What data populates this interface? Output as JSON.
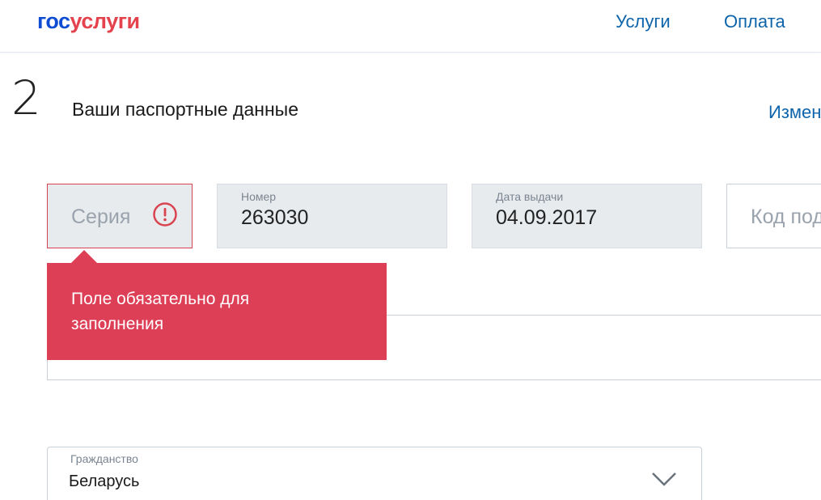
{
  "header": {
    "logo_part1": "гос",
    "logo_part2": "услуги",
    "nav": [
      {
        "label": "Услуги"
      },
      {
        "label": "Оплата"
      }
    ]
  },
  "step": {
    "number": "2",
    "title": "Ваши паспортные данные",
    "edit_label": "Измен"
  },
  "passport": {
    "series": {
      "placeholder": "Серия",
      "value": "",
      "state": "error"
    },
    "number": {
      "label": "Номер",
      "value": "263030"
    },
    "issue_date": {
      "label": "Дата выдачи",
      "value": "04.09.2017"
    },
    "division_code": {
      "placeholder": "Код под"
    }
  },
  "error_tooltip": {
    "line1": "Поле обязательно для",
    "line2": "заполнения"
  },
  "citizenship": {
    "label": "Гражданство",
    "value": "Беларусь"
  },
  "colors": {
    "brand_blue": "#0d4cd3",
    "brand_red": "#e4424d",
    "link_blue": "#0d64ab",
    "error": "#dd3f56"
  },
  "icons": [
    "error-icon",
    "chevron-down-icon"
  ]
}
